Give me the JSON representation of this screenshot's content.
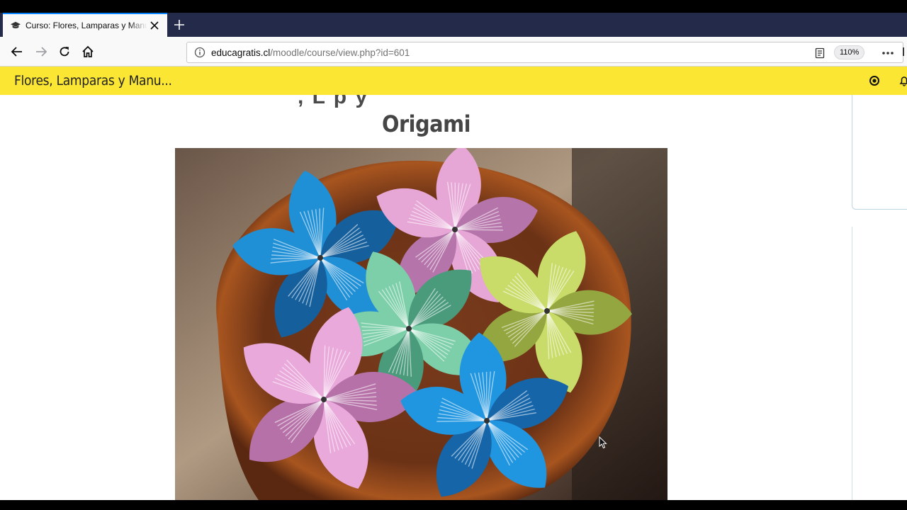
{
  "browser": {
    "tab_title": "Curso: Flores, Lamparas y Manualidades",
    "url_domain": "educagratis.cl",
    "url_path": "/moodle/course/view.php?id=601",
    "zoom": "110%"
  },
  "moodle": {
    "course_short": "Flores, Lamparas y Manu...",
    "accent_color": "#fbe733"
  },
  "content": {
    "partial_heading": ", L p   y",
    "heading": "Origami",
    "image_alt": "Origami kusudama flowers in a wooden bowl"
  }
}
